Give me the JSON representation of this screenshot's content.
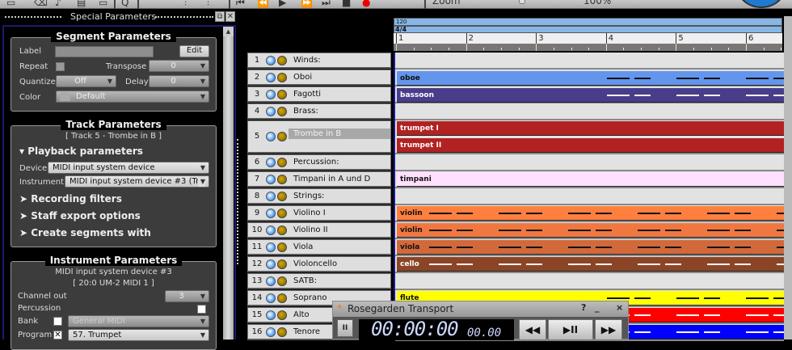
{
  "toolbar": {
    "zoom_label": "Zoom",
    "zoom_value": "100%"
  },
  "dock": {
    "title": "Special Parameters",
    "float_icon": "float-icon",
    "close_icon": "close-icon"
  },
  "segment_params": {
    "title": "Segment Parameters",
    "label_label": "Label",
    "label_value": "",
    "edit_button": "Edit",
    "repeat_label": "Repeat",
    "repeat_checked": false,
    "transpose_label": "Transpose",
    "transpose_value": "0",
    "quantize_label": "Quantize",
    "quantize_value": "Off",
    "delay_label": "Delay",
    "delay_value": "0",
    "color_label": "Color",
    "color_value": "Default"
  },
  "track_params": {
    "title": "Track Parameters",
    "subtitle": "[ Track 5 - Trombe in B ]",
    "playback": "▾ Playback parameters",
    "device_label": "Device",
    "device_value": "MIDI input system device",
    "instrument_label": "Instrument",
    "instrument_value": "MIDI input system device #3 (Tr",
    "recording": "➤ Recording filters",
    "staff": "➤ Staff export options",
    "create": "➤ Create segments with"
  },
  "instrument_params": {
    "title": "Instrument Parameters",
    "device": "MIDI input system device  #3",
    "port": "[ 20:0 UM-2 MIDI 1 ]",
    "channel_label": "Channel out",
    "channel_value": "3",
    "percussion_label": "Percussion",
    "percussion_checked": false,
    "bank_label": "Bank",
    "bank_checked": false,
    "bank_value": "General MIDI",
    "program_label": "Program",
    "program_checked": true,
    "program_value": "57. Trumpet"
  },
  "ruler": {
    "tempo": "120",
    "time_signature": "4/4",
    "bars": [
      "1",
      "2",
      "3",
      "4",
      "5",
      "6"
    ]
  },
  "tracks": [
    {
      "num": "1",
      "name": "Winds:"
    },
    {
      "num": "2",
      "name": "Oboi"
    },
    {
      "num": "3",
      "name": "Fagotti"
    },
    {
      "num": "4",
      "name": "Brass:"
    },
    {
      "num": "5",
      "name": "Trombe in B"
    },
    {
      "num": "6",
      "name": "Percussion:"
    },
    {
      "num": "7",
      "name": "Timpani in A und D"
    },
    {
      "num": "8",
      "name": "Strings:"
    },
    {
      "num": "9",
      "name": "Violino I"
    },
    {
      "num": "10",
      "name": "Violino II"
    },
    {
      "num": "11",
      "name": "Viola"
    },
    {
      "num": "12",
      "name": "Violoncello"
    },
    {
      "num": "13",
      "name": "SATB:"
    },
    {
      "num": "14",
      "name": "Soprano"
    },
    {
      "num": "15",
      "name": "Alto"
    },
    {
      "num": "16",
      "name": "Tenore"
    }
  ],
  "segments": [
    {
      "label": "oboe",
      "color": "#6495ed",
      "text": "#111"
    },
    {
      "label": "bassoon",
      "color": "#483d8b",
      "text": "#fff"
    },
    {
      "label": "trumpet I",
      "color": "#b22222",
      "text": "#fff"
    },
    {
      "label": "trumpet II",
      "color": "#b22222",
      "text": "#fff"
    },
    {
      "label": "timpani",
      "color": "#ffe0ff",
      "text": "#111"
    },
    {
      "label": "violin",
      "color": "#ff7f3f",
      "text": "#111"
    },
    {
      "label": "violin",
      "color": "#f07840",
      "text": "#111"
    },
    {
      "label": "viola",
      "color": "#d2693a",
      "text": "#111"
    },
    {
      "label": "cello",
      "color": "#8b4526",
      "text": "#fff"
    },
    {
      "label": "flute",
      "color": "#ffff00",
      "text": "#111"
    },
    {
      "label": "",
      "color": "#ff0000",
      "text": "#fff"
    },
    {
      "label": "",
      "color": "#0000ff",
      "text": "#fff"
    }
  ],
  "transport": {
    "title": "Rosegarden Transport",
    "help": "?",
    "minimize": "_",
    "close": "×",
    "pause": "II",
    "time": "00:00:00",
    "time_small": "00.00",
    "rewind": "◀◀",
    "play": "▶II",
    "ffwd": "▶▶"
  }
}
